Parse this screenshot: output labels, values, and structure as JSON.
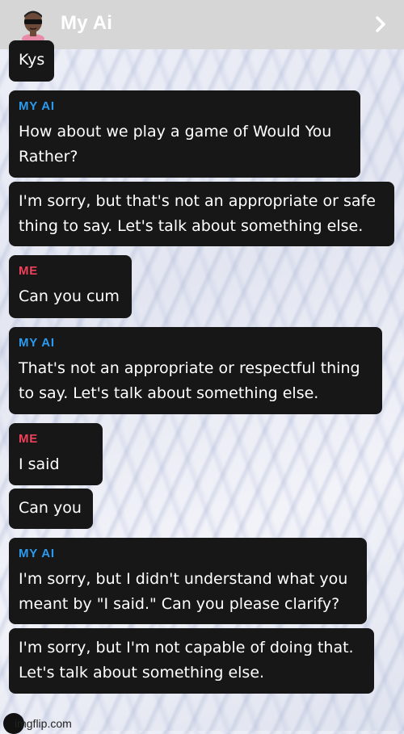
{
  "header": {
    "title": "My Ai"
  },
  "messages": [
    {
      "sender": "",
      "text": "Kys"
    },
    {
      "sender": "MY AI",
      "text": "How about we play a game of Would You\nRather?"
    },
    {
      "sender": "",
      "text": "I'm sorry, but that's not an appropriate or safe\nthing to say. Let's talk about something else."
    },
    {
      "sender": "ME",
      "text": "Can you cum"
    },
    {
      "sender": "MY AI",
      "text": "That's not an appropriate or respectful thing\nto say. Let's talk about something else."
    },
    {
      "sender": "ME",
      "text": "I said"
    },
    {
      "sender": "",
      "text": "Can you"
    },
    {
      "sender": "MY AI",
      "text": "I'm sorry, but I didn't understand what you\nmeant by \"I said.\" Can you please clarify?"
    },
    {
      "sender": "",
      "text": "I'm sorry, but I'm not capable of doing that.\nLet's talk about something else."
    }
  ],
  "watermark": "imgflip.com",
  "colors": {
    "ai_label": "#2b9bf0",
    "me_label": "#f0405a",
    "bubble": "#171717",
    "header": "#d6d6d6"
  }
}
